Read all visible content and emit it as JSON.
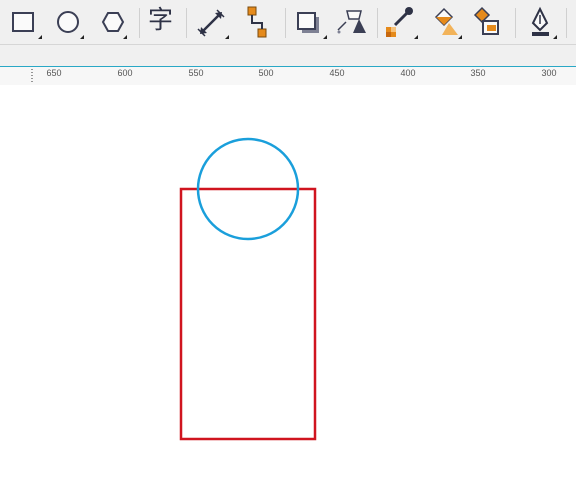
{
  "toolbar": {
    "tools": [
      {
        "name": "rectangle-tool",
        "icon": "rectangle-icon"
      },
      {
        "name": "ellipse-tool",
        "icon": "ellipse-icon"
      },
      {
        "name": "polygon-tool",
        "icon": "hexagon-icon"
      },
      {
        "name": "text-tool",
        "icon": "text-glyph-icon",
        "glyph": "字"
      },
      {
        "name": "dimension-tool",
        "icon": "dimension-arrow-icon"
      },
      {
        "name": "connector-tool",
        "icon": "connector-icon"
      },
      {
        "name": "drop-shadow-tool",
        "icon": "drop-shadow-icon"
      },
      {
        "name": "transparency-tool",
        "icon": "transparency-icon"
      },
      {
        "name": "color-eyedropper-tool",
        "icon": "eyedropper-icon"
      },
      {
        "name": "interactive-fill-tool",
        "icon": "fill-bucket-icon"
      },
      {
        "name": "smart-fill-tool",
        "icon": "smart-fill-icon"
      },
      {
        "name": "outline-pen-tool",
        "icon": "pen-nib-icon"
      }
    ]
  },
  "ruler": {
    "ticks": [
      "650",
      "600",
      "550",
      "500",
      "450",
      "400",
      "350",
      "300"
    ]
  },
  "colors": {
    "accent": "#29a8c6",
    "circle_stroke": "#1a9fdb",
    "rect_stroke": "#d0141f",
    "icon_dark": "#3b3f55",
    "icon_orange": "#e58a1b"
  },
  "canvas": {
    "shapes": [
      {
        "type": "circle",
        "name": "blue-circle"
      },
      {
        "type": "rectangle",
        "name": "red-rectangle"
      }
    ]
  }
}
